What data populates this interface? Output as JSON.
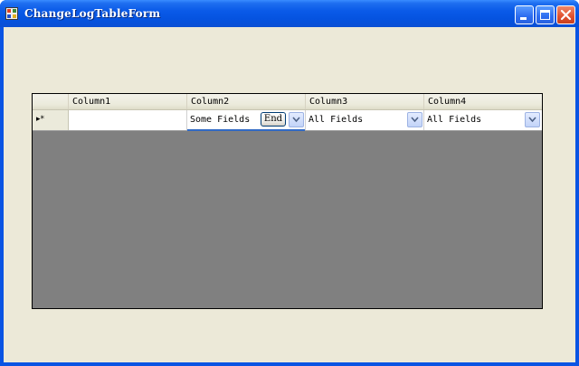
{
  "window": {
    "title": "ChangeLogTableForm"
  },
  "grid": {
    "columns": [
      "Column1",
      "Column2",
      "Column3",
      "Column4"
    ],
    "new_row_marker": "▸*",
    "row": {
      "col1_value": "",
      "col2_value": "Some Fields",
      "col2_button": "End",
      "col3_value": "All Fields",
      "col4_value": "All Fields"
    }
  },
  "colors": {
    "titlebar": "#0a54e3",
    "client_bg": "#ece9d8",
    "grid_bg": "#808080",
    "selection_accent": "#316ac5"
  }
}
